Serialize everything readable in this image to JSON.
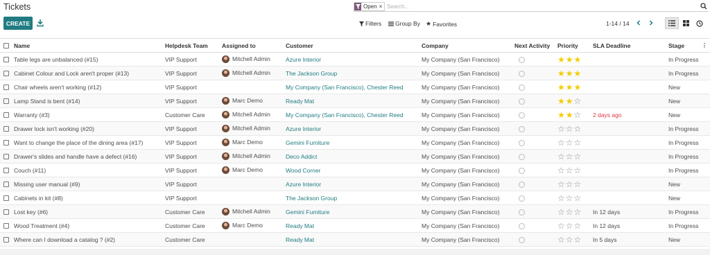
{
  "header": {
    "title": "Tickets",
    "create_label": "CREATE",
    "download_icon": "download-icon"
  },
  "search": {
    "facet_label": "Open",
    "facet_close": "×",
    "placeholder": "Search..."
  },
  "controls": {
    "filters_label": "Filters",
    "groupby_label": "Group By",
    "favorites_label": "Favorites",
    "pager": "1-14 / 14"
  },
  "colors": {
    "accent": "#217c82",
    "facet": "#7c5a7a",
    "star": "#f3cc00",
    "danger": "#dc3545"
  },
  "columns": [
    "Name",
    "Helpdesk Team",
    "Assigned to",
    "Customer",
    "Company",
    "Next Activity",
    "Priority",
    "SLA Deadline",
    "Stage"
  ],
  "rows": [
    {
      "name": "Table legs are unbalanced (#15)",
      "team": "VIP Support",
      "assigned": "Mitchell Admin",
      "customer": "Azure Interior",
      "company": "My Company (San Francisco)",
      "priority": 3,
      "sla": "",
      "stage": "In Progress"
    },
    {
      "name": "Cabinet Colour and Lock aren't proper (#13)",
      "team": "VIP Support",
      "assigned": "Mitchell Admin",
      "customer": "The Jackson Group",
      "company": "My Company (San Francisco)",
      "priority": 3,
      "sla": "",
      "stage": "In Progress"
    },
    {
      "name": "Chair wheels aren't working (#12)",
      "team": "VIP Support",
      "assigned": "",
      "customer": "My Company (San Francisco), Chester Reed",
      "company": "My Company (San Francisco)",
      "priority": 3,
      "sla": "",
      "stage": "New"
    },
    {
      "name": "Lamp Stand is bent (#14)",
      "team": "VIP Support",
      "assigned": "Marc Demo",
      "customer": "Ready Mat",
      "company": "My Company (San Francisco)",
      "priority": 2,
      "sla": "",
      "stage": "New"
    },
    {
      "name": "Warranty (#3)",
      "team": "Customer Care",
      "assigned": "Mitchell Admin",
      "customer": "My Company (San Francisco), Chester Reed",
      "company": "My Company (San Francisco)",
      "priority": 2,
      "sla": "2 days ago",
      "sla_late": true,
      "stage": "New"
    },
    {
      "name": "Drawer lock isn't working (#20)",
      "team": "VIP Support",
      "assigned": "Mitchell Admin",
      "customer": "Azure Interior",
      "company": "My Company (San Francisco)",
      "priority": 0,
      "sla": "",
      "stage": "In Progress"
    },
    {
      "name": "Want to change the place of the dining area (#17)",
      "team": "VIP Support",
      "assigned": "Marc Demo",
      "customer": "Gemini Furniture",
      "company": "My Company (San Francisco)",
      "priority": 0,
      "sla": "",
      "stage": "In Progress"
    },
    {
      "name": "Drawer's slides and handle have a defect (#16)",
      "team": "VIP Support",
      "assigned": "Mitchell Admin",
      "customer": "Deco Addict",
      "company": "My Company (San Francisco)",
      "priority": 0,
      "sla": "",
      "stage": "In Progress"
    },
    {
      "name": "Couch (#11)",
      "team": "VIP Support",
      "assigned": "Marc Demo",
      "customer": "Wood Corner",
      "company": "My Company (San Francisco)",
      "priority": 0,
      "sla": "",
      "stage": "In Progress"
    },
    {
      "name": "Missing user manual (#9)",
      "team": "VIP Support",
      "assigned": "",
      "customer": "Azure Interior",
      "company": "My Company (San Francisco)",
      "priority": 0,
      "sla": "",
      "stage": "New"
    },
    {
      "name": "Cabinets in kit (#8)",
      "team": "VIP Support",
      "assigned": "",
      "customer": "The Jackson Group",
      "company": "My Company (San Francisco)",
      "priority": 0,
      "sla": "",
      "stage": "New"
    },
    {
      "name": "Lost key (#6)",
      "team": "Customer Care",
      "assigned": "Mitchell Admin",
      "customer": "Gemini Furniture",
      "company": "My Company (San Francisco)",
      "priority": 0,
      "sla": "In 12 days",
      "stage": "In Progress"
    },
    {
      "name": "Wood Treatment (#4)",
      "team": "Customer Care",
      "assigned": "Marc Demo",
      "customer": "Ready Mat",
      "company": "My Company (San Francisco)",
      "priority": 0,
      "sla": "In 12 days",
      "stage": "In Progress"
    },
    {
      "name": "Where can I download a catalog ? (#2)",
      "team": "Customer Care",
      "assigned": "",
      "customer": "Ready Mat",
      "company": "My Company (San Francisco)",
      "priority": 0,
      "sla": "In 5 days",
      "stage": "New"
    }
  ]
}
